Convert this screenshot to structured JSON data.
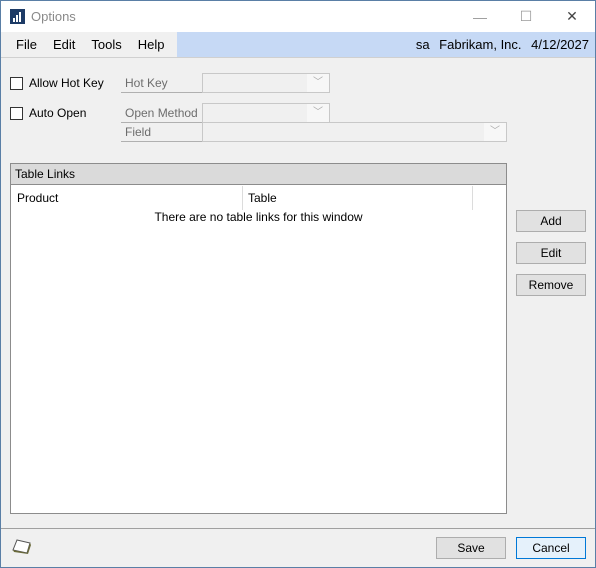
{
  "window": {
    "title": "Options",
    "controls": {
      "minimize": "—",
      "maximize": "☐",
      "close": "✕"
    }
  },
  "menubar": {
    "items": [
      "File",
      "Edit",
      "Tools",
      "Help"
    ],
    "user": "sa",
    "company": "Fabrikam, Inc.",
    "date": "4/12/2027"
  },
  "options": {
    "allow_hot_key": {
      "label": "Allow Hot Key",
      "checked": false
    },
    "hot_key": {
      "label": "Hot Key",
      "value": ""
    },
    "auto_open": {
      "label": "Auto Open",
      "checked": false
    },
    "open_method": {
      "label": "Open Method",
      "value": ""
    },
    "field": {
      "label": "Field",
      "value": ""
    },
    "dropdown_arrow": "﹀"
  },
  "table_links": {
    "title": "Table Links",
    "columns": [
      "Product",
      "Table"
    ],
    "rows": [],
    "empty_message": "There are no table links for this window"
  },
  "side_buttons": {
    "add": "Add",
    "edit": "Edit",
    "remove": "Remove"
  },
  "footer": {
    "save": "Save",
    "cancel": "Cancel",
    "note_icon": "note-icon"
  }
}
